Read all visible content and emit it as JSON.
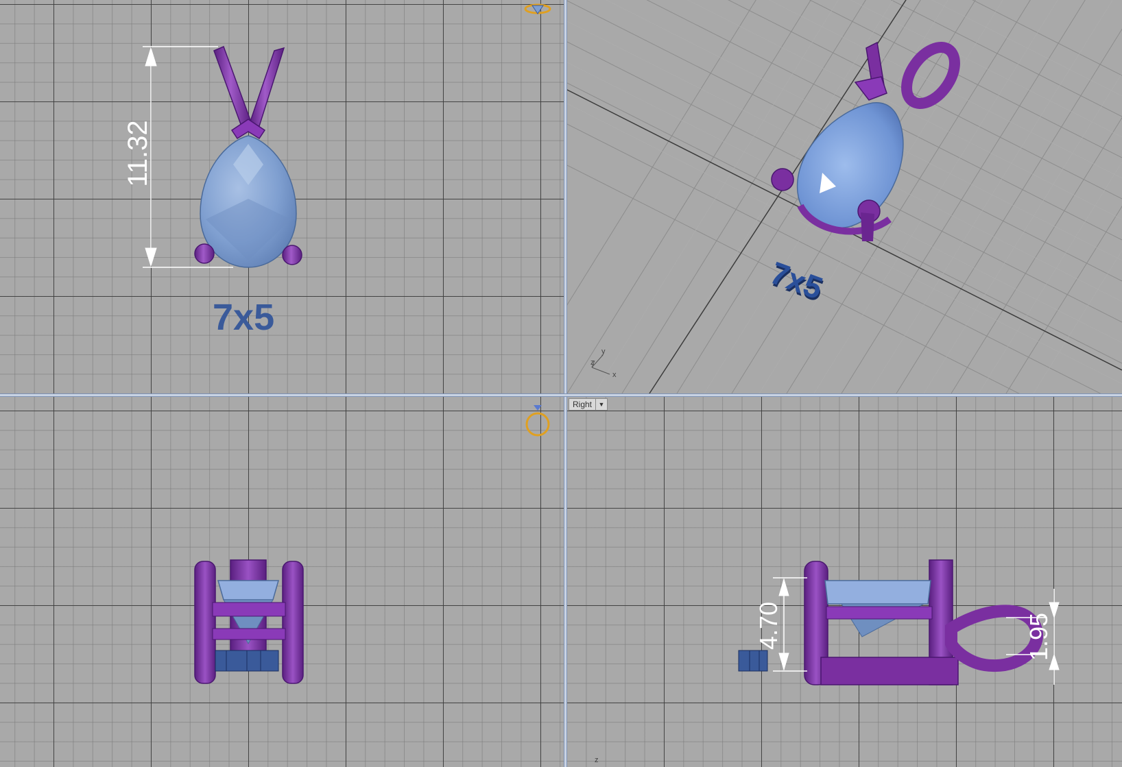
{
  "viewports": {
    "top_left": {
      "label": "7x5",
      "dimension": "11.32"
    },
    "top_right": {
      "label": "7x5",
      "axis_x": "x",
      "axis_y": "y",
      "axis_z": "z"
    },
    "bottom_left": {},
    "bottom_right": {
      "view_name": "Right",
      "dimension_height": "4.70",
      "dimension_bail": "1.95",
      "axis_z": "z"
    }
  },
  "colors": {
    "metal": "#7a2fa0",
    "stone": "#7f9fd0",
    "label": "#3a5a9a",
    "grid_major": "#3c3c3c",
    "grid_minor": "#787878",
    "background": "#a9a9a9"
  },
  "icons": [
    "ring-gizmo-icon",
    "gem-gizmo-icon",
    "view-dropdown-icon",
    "axis-triad-icon"
  ]
}
